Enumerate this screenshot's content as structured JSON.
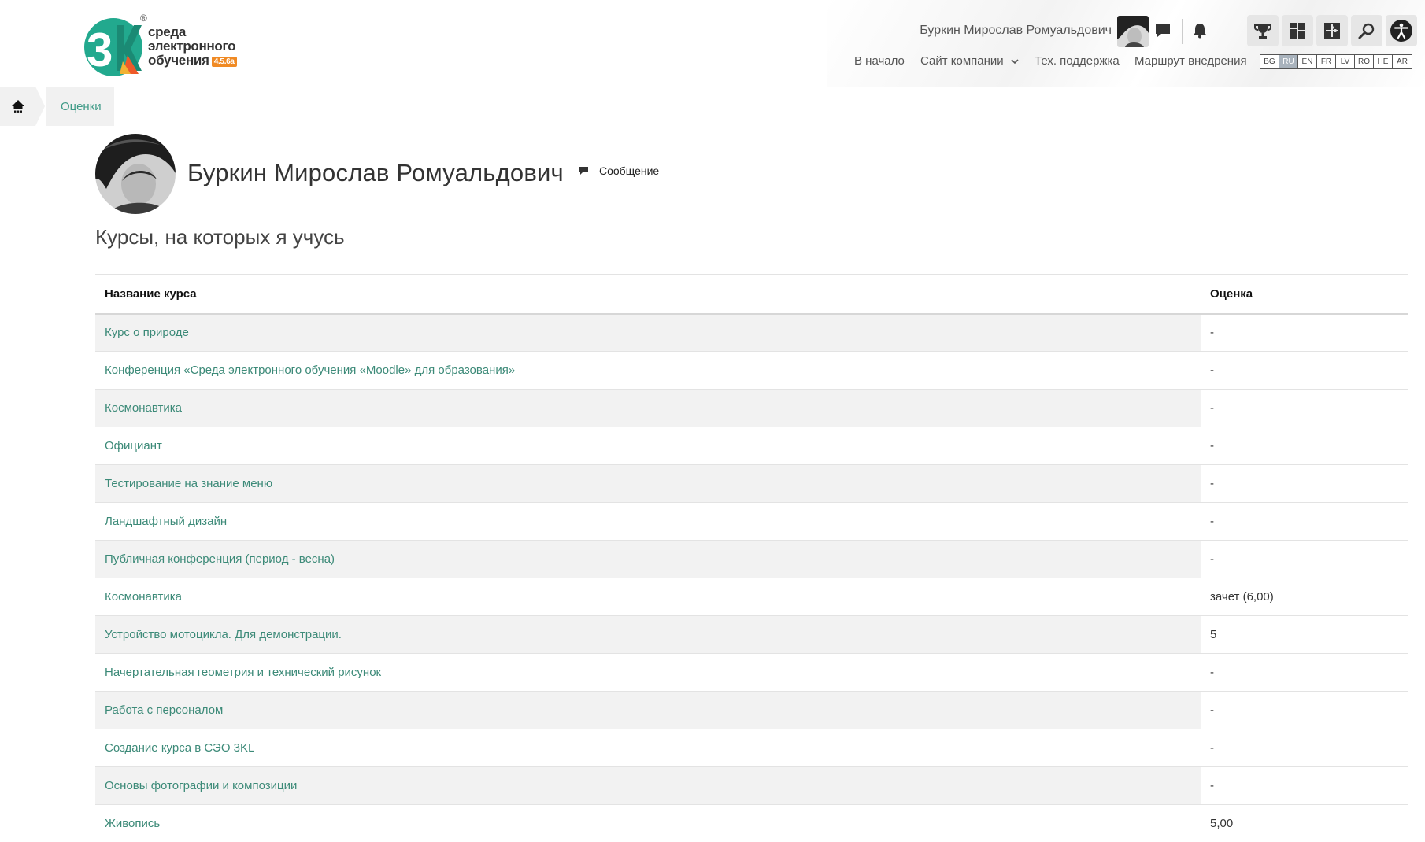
{
  "header": {
    "logo": {
      "line1": "среда",
      "line2": "электронного",
      "line3": "обучения",
      "version": "4.5.6a",
      "registered_mark": "®",
      "brand_colors": [
        "#22a98e",
        "#ee5a2a",
        "#f2b233",
        "#1e8fc6"
      ]
    },
    "user_name": "Буркин Мирослав Ромуальдович",
    "icons": [
      "chat-icon",
      "bell-icon",
      "trophy-icon",
      "dashboard-icon",
      "puzzle-icon",
      "search-icon",
      "accessibility-icon"
    ],
    "nav": {
      "home": "В начало",
      "company_site": "Сайт компании",
      "support": "Тех. поддержка",
      "roadmap": "Маршрут внедрения"
    },
    "languages": [
      "BG",
      "RU",
      "EN",
      "FR",
      "LV",
      "RO",
      "HE",
      "AR"
    ],
    "active_language": "RU"
  },
  "breadcrumb": {
    "current": "Оценки"
  },
  "profile": {
    "name": "Буркин Мирослав Ромуальдович",
    "message_label": "Сообщение"
  },
  "section_title": "Курсы, на которых я учусь",
  "table": {
    "headers": {
      "course": "Название курса",
      "grade": "Оценка"
    },
    "rows": [
      {
        "course": "Курс о природе",
        "grade": "-"
      },
      {
        "course": "Конференция «Среда электронного обучения «Moodle» для образования»",
        "grade": "-"
      },
      {
        "course": "Космонавтика",
        "grade": "-"
      },
      {
        "course": "Официант",
        "grade": "-"
      },
      {
        "course": "Тестирование на знание меню",
        "grade": "-"
      },
      {
        "course": "Ландшафтный дизайн",
        "grade": "-"
      },
      {
        "course": "Публичная конференция (период - весна)",
        "grade": "-"
      },
      {
        "course": "Космонавтика",
        "grade": "зачет (6,00)"
      },
      {
        "course": "Устройство мотоцикла. Для демонстрации.",
        "grade": "5"
      },
      {
        "course": "Начертательная геометрия и технический рисунок",
        "grade": "-"
      },
      {
        "course": "Работа с персоналом",
        "grade": "-"
      },
      {
        "course": "Создание курса в СЭО 3KL",
        "grade": "-"
      },
      {
        "course": "Основы фотографии и композиции",
        "grade": "-"
      },
      {
        "course": "Живопись",
        "grade": "5,00"
      }
    ]
  },
  "colors": {
    "accent_link": "#3c8a78",
    "breadcrumb_bg": "#f1f1f1",
    "striped_row": "#f2f2f2"
  }
}
